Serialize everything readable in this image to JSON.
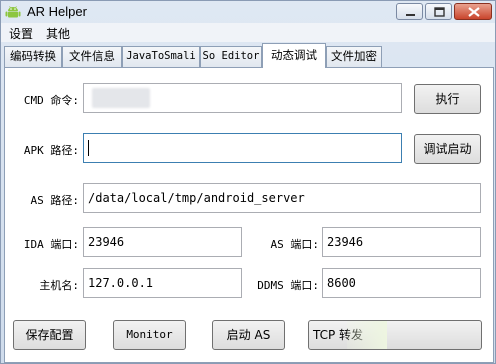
{
  "window": {
    "title": "AR Helper"
  },
  "menu": {
    "items": [
      "设置",
      "其他"
    ]
  },
  "tabs": [
    {
      "label": "编码转换"
    },
    {
      "label": "文件信息"
    },
    {
      "label": "JavaToSmali"
    },
    {
      "label": "So Editor"
    },
    {
      "label": "动态调试"
    },
    {
      "label": "文件加密"
    }
  ],
  "active_tab": "动态调试",
  "form": {
    "cmd_label": "CMD 命令:",
    "cmd_value": "",
    "apk_label": "APK 路径:",
    "apk_value": "",
    "as_path_label": "AS 路径:",
    "as_path_value": "/data/local/tmp/android_server",
    "ida_port_label": "IDA 端口:",
    "ida_port_value": "23946",
    "as_port_label": "AS 端口:",
    "as_port_value": "23946",
    "host_label": "主机名:",
    "host_value": "127.0.0.1",
    "ddms_port_label": "DDMS 端口:",
    "ddms_port_value": "8600"
  },
  "buttons": {
    "execute": "执行",
    "debug_launch": "调试启动",
    "save_config": "保存配置",
    "monitor": "Monitor",
    "start_as": "启动 AS",
    "tcp_forward": "TCP 转发"
  },
  "colors": {
    "titlebar": "#dfe8f3",
    "close_button": "#c9452c",
    "focus_border": "#3c7fb1"
  },
  "icons": {
    "app": "android-icon",
    "minimize": "minimize-icon",
    "maximize": "maximize-icon",
    "close": "close-icon"
  }
}
